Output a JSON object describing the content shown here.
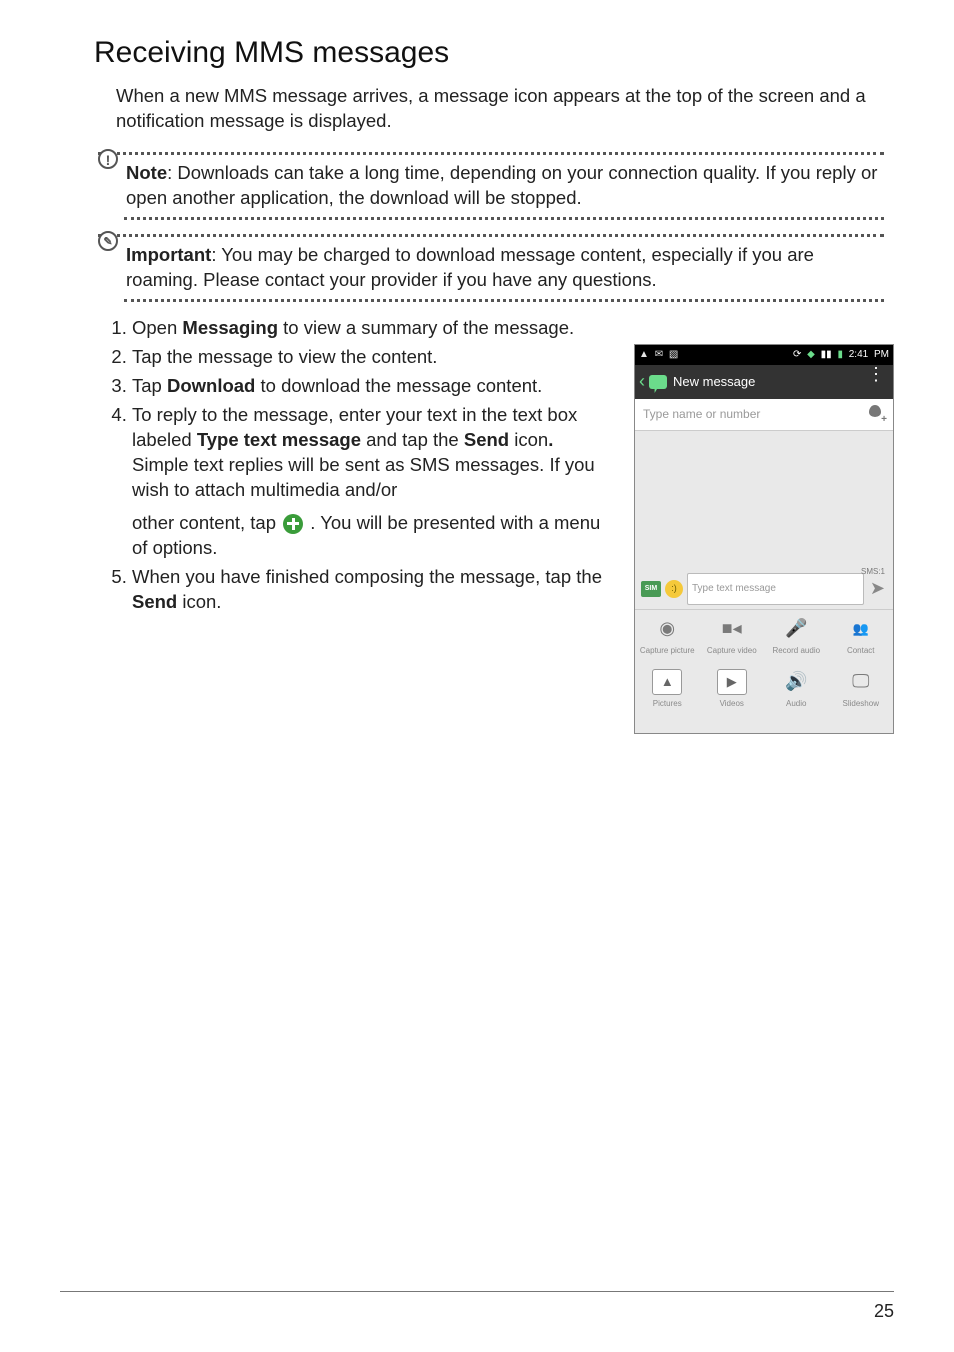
{
  "heading": "Receiving MMS messages",
  "intro": "When a new MMS message arrives, a message icon appears at the top of the screen and a notification message is displayed.",
  "note": {
    "label": "Note",
    "text": ": Downloads can take a long time, depending on your connection quality. If you reply or open another application, the download will be stopped."
  },
  "important": {
    "label": "Important",
    "text": ": You may be charged to download message content, especially if you are roaming. Please contact your provider if you have any questions."
  },
  "steps": {
    "s1a": "Open ",
    "s1b": "Messaging",
    "s1c": " to view a summary of the message.",
    "s2": "Tap the message to view the content.",
    "s3a": "Tap ",
    "s3b": "Download",
    "s3c": " to download the message content.",
    "s4a": "To reply to the message, enter your text in the text box labeled ",
    "s4b": "Type text message",
    "s4c": " and tap the ",
    "s4d": "Send",
    "s4e": " icon",
    "s4f": ".",
    "s4g": " Simple text replies will be sent as SMS messages. If you wish to attach multimedia and/or ",
    "s4h": "other content, tap ",
    "s4i": " . You will be presented with a menu of options.",
    "s5a": "When you have finished composing the message, tap the ",
    "s5b": "Send",
    "s5c": " icon."
  },
  "phone": {
    "time": "2:41",
    "pm": " PM",
    "header_title": "New message",
    "recipient_placeholder": "Type name or number",
    "compose_placeholder": "Type text message",
    "sms_counter": "SMS:1",
    "sim_label": "SIM",
    "attachments": {
      "a1": "Capture picture",
      "a2": "Capture video",
      "a3": "Record audio",
      "a4": "Contact",
      "a5": "Pictures",
      "a6": "Videos",
      "a7": "Audio",
      "a8": "Slideshow"
    }
  },
  "page_number": "25"
}
